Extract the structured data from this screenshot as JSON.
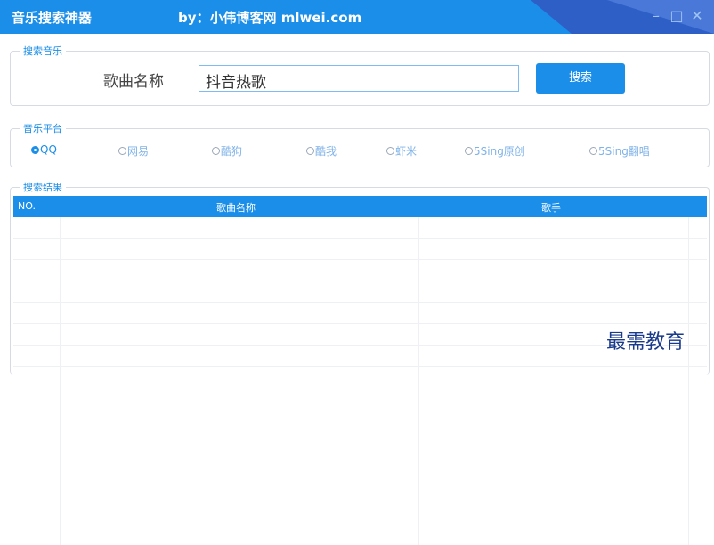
{
  "window": {
    "title": "音乐搜索神器",
    "subtitle": "by：小伟博客网 mlwei.com",
    "controls": [
      "–",
      "□",
      "✕"
    ]
  },
  "search_group": {
    "title": "搜索音乐",
    "song_label": "歌曲名称",
    "song_value": "抖音热歌",
    "search_button": "搜索"
  },
  "platform_group": {
    "title": "音乐平台",
    "options": [
      "QQ",
      "网易",
      "酷狗",
      "酷我",
      "虾米",
      "5Sing原创",
      "5Sing翻唱"
    ],
    "selected": "QQ"
  },
  "results_group": {
    "title": "搜索结果",
    "columns": [
      "NO.",
      "歌曲名称",
      "歌手"
    ],
    "rows": []
  },
  "watermark": "最需教育",
  "colors": {
    "accent": "#1a8ee8",
    "titlebar_dark": "#2e5fc7"
  }
}
